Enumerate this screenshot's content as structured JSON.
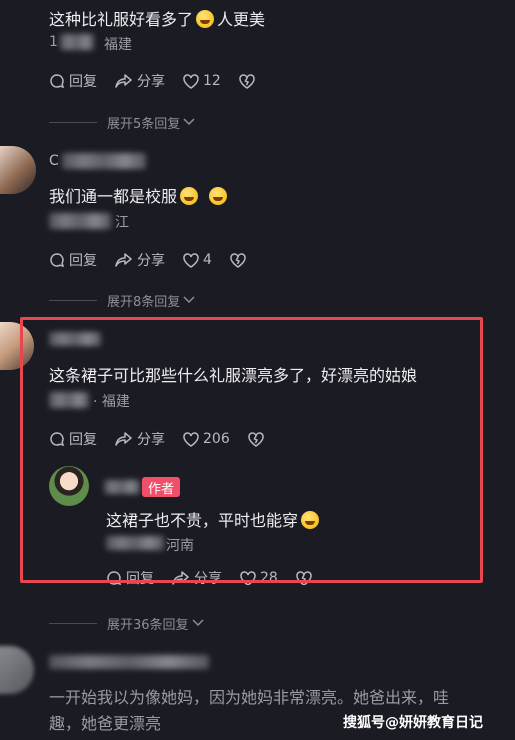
{
  "comments": [
    {
      "text": "这种比礼服好看多了",
      "text_suffix": "人更美",
      "location": "福建",
      "meta_prefix": "1",
      "reply_label": "回复",
      "share_label": "分享",
      "likes": "12",
      "expand_label": "展开5条回复"
    },
    {
      "username_prefix": "C",
      "text": "我们通一都是校服",
      "location": "江",
      "reply_label": "回复",
      "share_label": "分享",
      "likes": "4",
      "expand_label": "展开8条回复"
    },
    {
      "text": "这条裙子可比那些什么礼服漂亮多了，好漂亮的姑娘",
      "location": "· 福建",
      "reply_label": "回复",
      "share_label": "分享",
      "likes": "206",
      "reply": {
        "badge": "作者",
        "text": "这裙子也不贵，平时也能穿",
        "location": "河南",
        "reply_label": "回复",
        "share_label": "分享",
        "likes": "28"
      },
      "expand_label": "展开36条回复"
    },
    {
      "text_line1": "一开始我以为像她妈，因为她妈非常漂亮。她爸出来，哇",
      "text_line2": "趣，她爸更漂亮"
    }
  ],
  "watermark": "搜狐号@妍妍教育日记",
  "colors": {
    "background": "#1b1c23",
    "highlight_border": "#e8474f",
    "author_badge": "#f04f6a"
  }
}
